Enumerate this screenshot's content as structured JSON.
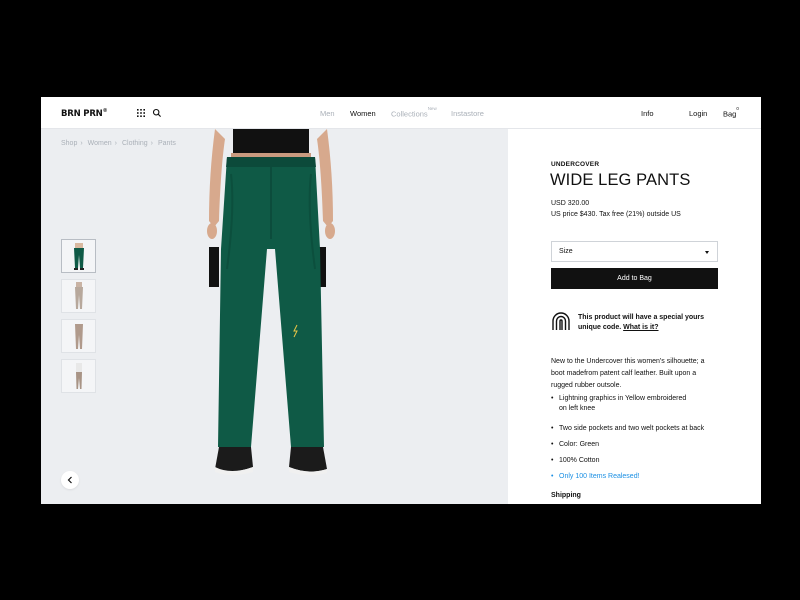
{
  "header": {
    "logo": "BRN PRN",
    "logo_mark": "®",
    "nav": [
      {
        "label": "Men"
      },
      {
        "label": "Women"
      },
      {
        "label": "Collections",
        "badge": "New"
      },
      {
        "label": "Instastore"
      }
    ],
    "info_label": "Info",
    "login_label": "Login",
    "bag_label": "Bag",
    "bag_count": "0"
  },
  "breadcrumb": [
    "Shop",
    "Women",
    "Clothing",
    "Pants"
  ],
  "breadcrumb_sep": "›",
  "product": {
    "brand": "UNDERCOVER",
    "title": "WIDE LEG PANTS",
    "price": "USD 320.00",
    "price_note": "US price $430. Tax free (21%) outside US",
    "size_label": "Size",
    "add_label": "Add to Bag",
    "code_text": "This product will have a special yours unique code.",
    "code_link": "What is it?",
    "description": "New to the Undercover this women's silhouette; a boot madefrom patent calf leather. Built upon a rugged rubber outsole.",
    "bullets": [
      "Lightning graphics in Yellow embroidered on left knee",
      "Two side pockets and two welt pockets at back",
      "Color: Green",
      "100% Cotton"
    ],
    "highlight": "Only 100 Items Realesed!",
    "shipping_label": "Shipping"
  },
  "colors": {
    "pants": "#0f5a46",
    "accent_link": "#1a8fe3",
    "gallery_bg": "#eceef1"
  }
}
